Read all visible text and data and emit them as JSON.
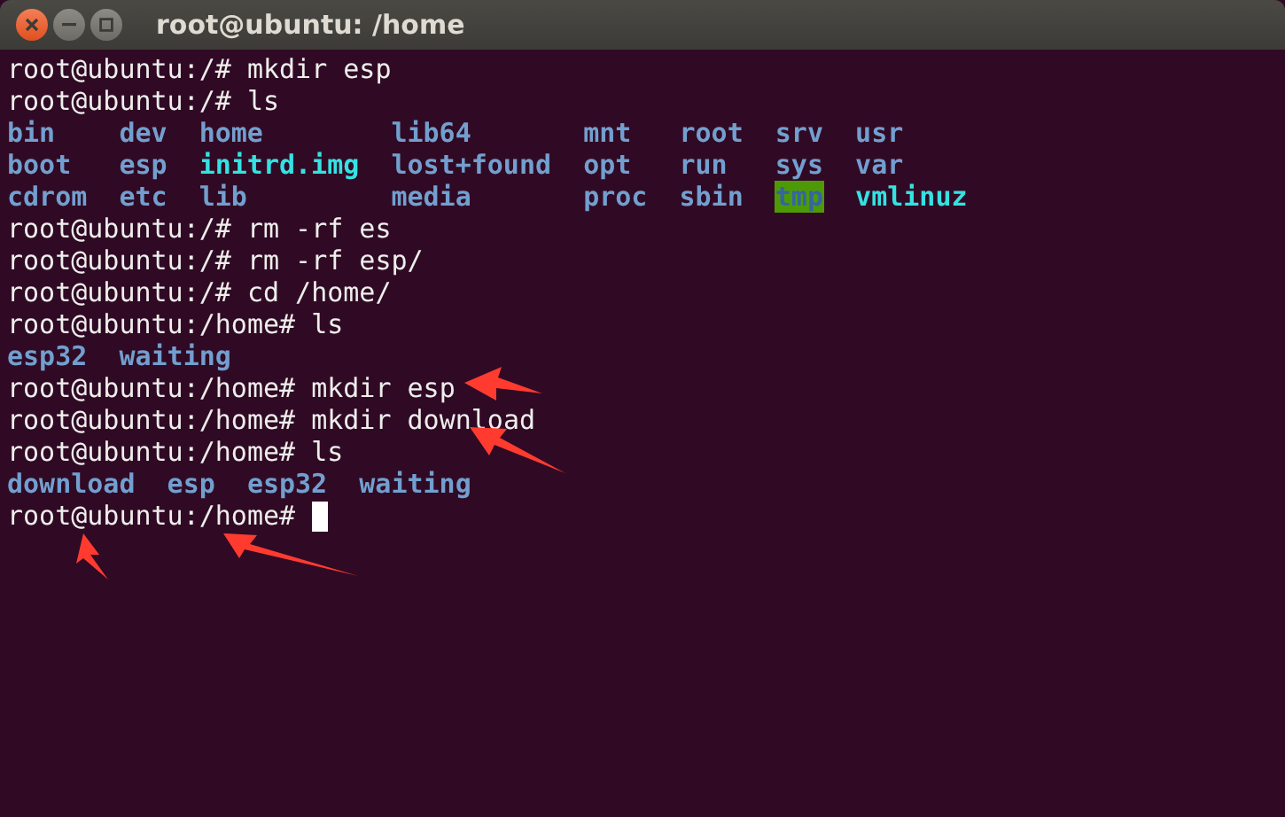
{
  "window": {
    "title": "root@ubuntu: /home"
  },
  "terminal": {
    "lines": [
      {
        "kind": "text",
        "text": "root@ubuntu:/# mkdir esp"
      },
      {
        "kind": "text",
        "text": "root@ubuntu:/# ls"
      },
      {
        "kind": "listing",
        "rows": [
          [
            {
              "name": "bin",
              "kind": "dir"
            },
            {
              "name": "dev",
              "kind": "dir"
            },
            {
              "name": "home",
              "kind": "dir"
            },
            {
              "name": "lib64",
              "kind": "dir"
            },
            {
              "name": "mnt",
              "kind": "dir"
            },
            {
              "name": "root",
              "kind": "dir"
            },
            {
              "name": "srv",
              "kind": "dir"
            },
            {
              "name": "usr",
              "kind": "dir"
            }
          ],
          [
            {
              "name": "boot",
              "kind": "dir"
            },
            {
              "name": "esp",
              "kind": "dir"
            },
            {
              "name": "initrd.img",
              "kind": "link"
            },
            {
              "name": "lost+found",
              "kind": "dir"
            },
            {
              "name": "opt",
              "kind": "dir"
            },
            {
              "name": "run",
              "kind": "dir"
            },
            {
              "name": "sys",
              "kind": "dir"
            },
            {
              "name": "var",
              "kind": "dir"
            }
          ],
          [
            {
              "name": "cdrom",
              "kind": "dir"
            },
            {
              "name": "etc",
              "kind": "dir"
            },
            {
              "name": "lib",
              "kind": "dir"
            },
            {
              "name": "media",
              "kind": "dir"
            },
            {
              "name": "proc",
              "kind": "dir"
            },
            {
              "name": "sbin",
              "kind": "dir"
            },
            {
              "name": "tmp",
              "kind": "sticky"
            },
            {
              "name": "vmlinuz",
              "kind": "link"
            }
          ]
        ]
      },
      {
        "kind": "text",
        "text": "root@ubuntu:/# rm -rf es"
      },
      {
        "kind": "text",
        "text": "root@ubuntu:/# rm -rf esp/"
      },
      {
        "kind": "text",
        "text": "root@ubuntu:/# cd /home/"
      },
      {
        "kind": "text",
        "text": "root@ubuntu:/home# ls"
      },
      {
        "kind": "listing",
        "rows": [
          [
            {
              "name": "esp32",
              "kind": "dir"
            },
            {
              "name": "waiting",
              "kind": "dir"
            }
          ]
        ]
      },
      {
        "kind": "text",
        "text": "root@ubuntu:/home# mkdir esp"
      },
      {
        "kind": "text",
        "text": "root@ubuntu:/home# mkdir download"
      },
      {
        "kind": "text",
        "text": "root@ubuntu:/home# ls"
      },
      {
        "kind": "listing",
        "rows": [
          [
            {
              "name": "download",
              "kind": "dir"
            },
            {
              "name": "esp",
              "kind": "dir"
            },
            {
              "name": "esp32",
              "kind": "dir"
            },
            {
              "name": "waiting",
              "kind": "dir"
            }
          ]
        ]
      },
      {
        "kind": "prompt",
        "text": "root@ubuntu:/home#",
        "cursor": true
      }
    ]
  }
}
